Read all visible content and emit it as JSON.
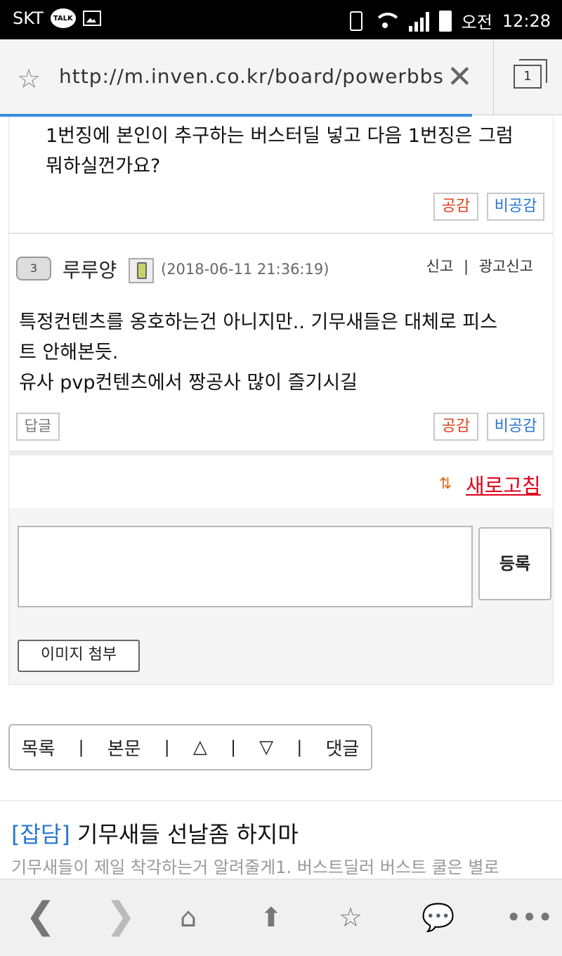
{
  "status": {
    "carrier": "SKT",
    "talk_badge": "TALK",
    "ampm": "오전",
    "time": "12:28"
  },
  "browser": {
    "url": "http://m.inven.co.kr/board/powerbbs",
    "tab_count": "1"
  },
  "comment1": {
    "text": "1번징에 본인이 추구하는 버스터딜 넣고 다음 1번징은 그럼 뭐하실껀가요?",
    "like_label": "공감",
    "dislike_label": "비공감"
  },
  "comment2": {
    "level": "3",
    "author": "루루양",
    "date": "(2018-06-11 21:36:19)",
    "report": "신고",
    "ad_report": "광고신고",
    "separator": "|",
    "line1": "특정컨텐츠를 옹호하는건 아니지만.. 기무새들은 대체로 피스",
    "line2": "트 안해본듯.",
    "line3": "유사 pvp컨텐츠에서 짱공사 많이 즐기시길",
    "reply_label": "답글",
    "like_label": "공감",
    "dislike_label": "비공감"
  },
  "refresh_label": "새로고침",
  "form": {
    "submit_label": "등록",
    "attach_label": "이미지 첨부"
  },
  "nav": {
    "list": "목록",
    "body": "본문",
    "up": "△",
    "down": "▽",
    "comments": "댓글",
    "sep": "|"
  },
  "next_post": {
    "category": "[잡담]",
    "title": "기무새들 선날좀 하지마",
    "preview": "기무새들이 제일 착각하는거 알려줄게1. 버스트딜러 버스트 쿨은 별로"
  }
}
